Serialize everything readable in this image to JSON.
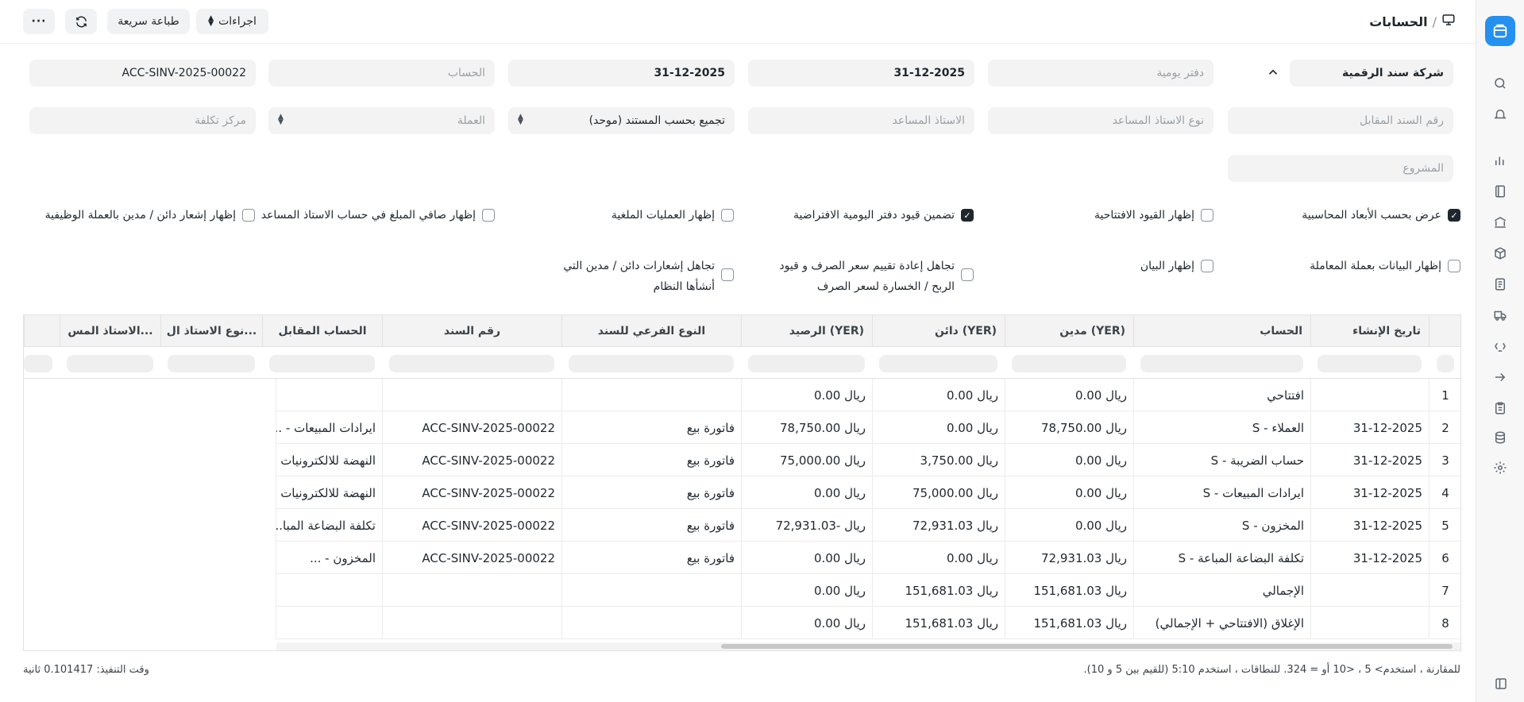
{
  "header": {
    "breadcrumb_sep": "/",
    "title": "الحسابات",
    "actions_label": "اجراءات",
    "quick_print_label": "طباعة سريعة"
  },
  "filters": {
    "company": "شركة سند الرقمية",
    "journal_book_placeholder": "دفتر يومية",
    "from_date": "31-12-2025",
    "to_date": "31-12-2025",
    "account_placeholder": "الحساب",
    "voucher_no": "ACC-SINV-2025-00022",
    "against_voucher_placeholder": "رقم السند المقابل",
    "party_type_placeholder": "نوع الاستاذ المساعد",
    "party_placeholder": "الاستاذ المساعد",
    "group_by": "تجميع بحسب المستند (موحد)",
    "currency_placeholder": "العملة",
    "cost_center_placeholder": "مركز تكلفة",
    "project_placeholder": "المشروع"
  },
  "checkboxes": {
    "dimensions": "عرض بحسب الأبعاد المحاسبية",
    "opening": "إظهار القيود الافتتاحية",
    "default_book": "تضمين قيود دفتر اليومية الافتراضية",
    "cancelled": "إظهار العمليات الملغية",
    "net_party": "إظهار صافي المبلغ في حساب الاستاذ المساعد",
    "cr_dr_notes": "إظهار إشعار دائن / مدين بالعملة الوظيفية",
    "txn_currency": "إظهار البيانات بعملة المعاملة",
    "remarks": "إظهار البيان",
    "ignore_reval": "تجاهل إعادة تقييم سعر الصرف و قيود الربح / الخسارة لسعر الصرف",
    "ignore_system": "تجاهل إشعارات دائن / مدين التي أنشأها النظام"
  },
  "table": {
    "columns": {
      "posting_date": "تاريخ الإنشاء",
      "account": "الحساب",
      "debit": "مدين (YER)",
      "credit": "دائن (YER)",
      "balance": "الرصيد (YER)",
      "voucher_subtype": "النوع الفرعي للسند",
      "voucher_no": "رقم السند",
      "against_account": "الحساب المقابل",
      "party_type": "نوع الاستاذ ال...",
      "party": "الاستاذ المس..."
    },
    "rows": [
      {
        "idx": "1",
        "date": "",
        "account": "افتتاحي",
        "debit": "ريال 0.00",
        "credit": "ريال 0.00",
        "balance": "ريال 0.00",
        "subtype": "",
        "voucher": "",
        "against": ""
      },
      {
        "idx": "2",
        "date": "31-12-2025",
        "account": "العملاء - S",
        "debit": "ريال 78,750.00",
        "credit": "ريال 0.00",
        "balance": "ريال 78,750.00",
        "subtype": "فاتورة بيع",
        "voucher": "ACC-SINV-2025-00022",
        "against": "ايرادات المبيعات - ..."
      },
      {
        "idx": "3",
        "date": "31-12-2025",
        "account": "حساب الضريبة - S",
        "debit": "ريال 0.00",
        "credit": "ريال 3,750.00",
        "balance": "ريال 75,000.00",
        "subtype": "فاتورة بيع",
        "voucher": "ACC-SINV-2025-00022",
        "against": "النهضة للالكترونيات"
      },
      {
        "idx": "4",
        "date": "31-12-2025",
        "account": "ايرادات المبيعات - S",
        "debit": "ريال 0.00",
        "credit": "ريال 75,000.00",
        "balance": "ريال 0.00",
        "subtype": "فاتورة بيع",
        "voucher": "ACC-SINV-2025-00022",
        "against": "النهضة للالكترونيات"
      },
      {
        "idx": "5",
        "date": "31-12-2025",
        "account": "المخزون - S",
        "debit": "ريال 0.00",
        "credit": "ريال 72,931.03",
        "balance": "ريال -72,931.03",
        "subtype": "فاتورة بيع",
        "voucher": "ACC-SINV-2025-00022",
        "against": "تكلفة البضاعة المبا..."
      },
      {
        "idx": "6",
        "date": "31-12-2025",
        "account": "تكلفة البضاعة المباعة - S",
        "debit": "ريال 72,931.03",
        "credit": "ريال 0.00",
        "balance": "ريال 0.00",
        "subtype": "فاتورة بيع",
        "voucher": "ACC-SINV-2025-00022",
        "against": "المخزون - ..."
      },
      {
        "idx": "7",
        "date": "",
        "account": "الإجمالي",
        "debit": "ريال 151,681.03",
        "credit": "ريال 151,681.03",
        "balance": "ريال 0.00",
        "subtype": "",
        "voucher": "",
        "against": ""
      },
      {
        "idx": "8",
        "date": "",
        "account": "الإغلاق (الافتتاحي + الإجمالي)",
        "debit": "ريال 151,681.03",
        "credit": "ريال 151,681.03",
        "balance": "ريال 0.00",
        "subtype": "",
        "voucher": "",
        "against": ""
      }
    ]
  },
  "footer": {
    "hint": "للمقارنة ، استخدم> 5 ، <10 أو = 324. للنطاقات ، استخدم 5:10 (للقيم بين 5 و 10).",
    "exec_time": "وقت التنفيذ: 0.101417 ثانية"
  },
  "colors": {
    "accent": "#2490ef"
  }
}
